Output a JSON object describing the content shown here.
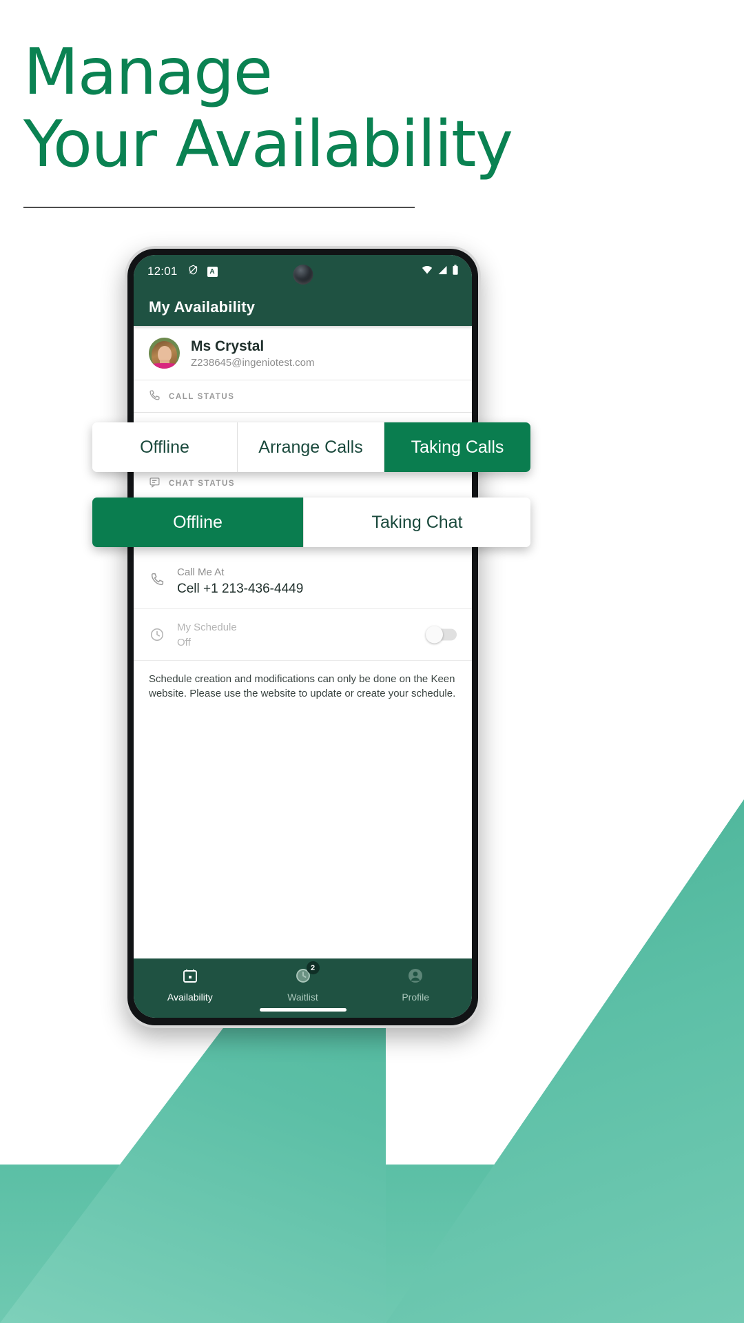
{
  "promo": {
    "headline_line1": "Manage",
    "headline_line2": "Your Availability",
    "accent_color": "#0a8252"
  },
  "phone": {
    "statusbar": {
      "time": "12:01",
      "icons": [
        "shield-icon",
        "a-badge-icon"
      ],
      "right_icons": [
        "wifi-icon",
        "cellular-signal-icon",
        "battery-icon"
      ]
    },
    "appbar": {
      "title": "My Availability"
    },
    "profile": {
      "name": "Ms Crystal",
      "email": "Z238645@ingeniotest.com"
    },
    "call_status": {
      "section_label": "CALL STATUS",
      "icon": "phone-icon",
      "options": [
        "Offline",
        "Arrange Calls",
        "Taking Calls"
      ],
      "selected": "Taking Calls"
    },
    "chat_status": {
      "section_label": "CHAT STATUS",
      "icon": "chat-bubble-icon",
      "options": [
        "Offline",
        "Taking Chat"
      ],
      "selected": "Offline"
    },
    "call_me_at": {
      "icon": "phone-icon",
      "label": "Call Me At",
      "value": "Cell +1 213-436-4449"
    },
    "my_schedule": {
      "icon": "clock-icon",
      "label": "My Schedule",
      "value": "Off",
      "toggle_state": "off"
    },
    "schedule_note": "Schedule creation and modifications can only be done on the Keen website. Please use the website to update or create your schedule.",
    "bottom_nav": [
      {
        "label": "Availability",
        "icon": "calendar-icon",
        "active": true,
        "badge": ""
      },
      {
        "label": "Waitlist",
        "icon": "clock-icon",
        "active": false,
        "badge": "2"
      },
      {
        "label": "Profile",
        "icon": "person-icon",
        "active": false,
        "badge": ""
      }
    ]
  },
  "colors": {
    "brand_green": "#0a7d4f",
    "appbar_green": "#1f5242",
    "teal": "#5cbfa6"
  }
}
